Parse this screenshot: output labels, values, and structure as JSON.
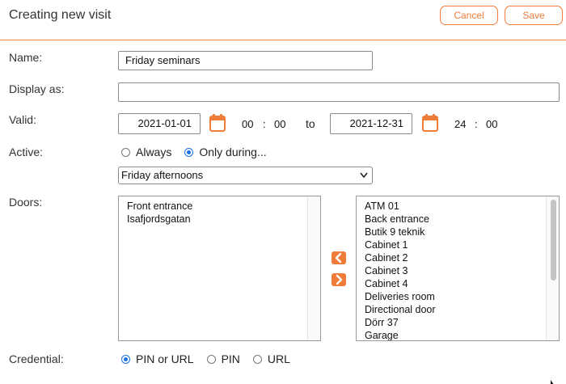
{
  "header": {
    "title": "Creating new visit",
    "cancel_label": "Cancel",
    "save_label": "Save"
  },
  "form": {
    "name": {
      "label": "Name:",
      "value": "Friday seminars"
    },
    "display_as": {
      "label": "Display as:",
      "value": ""
    },
    "valid": {
      "label": "Valid:",
      "start_date": "2021-01-01",
      "start_hour": "00",
      "start_minute": "00",
      "to_word": "to",
      "end_date": "2021-12-31",
      "end_hour": "24",
      "end_minute": "00",
      "separator": ":"
    },
    "active": {
      "label": "Active:",
      "options": [
        "Always",
        "Only during..."
      ],
      "selected": "Only during...",
      "schedule_value": "Friday afternoons"
    },
    "doors": {
      "label": "Doors:",
      "selected_doors": [
        "Front entrance",
        "Isafjordsgatan"
      ],
      "available_doors": [
        "ATM 01",
        "Back entrance",
        "Butik 9 teknik",
        "Cabinet 1",
        "Cabinet 2",
        "Cabinet 3",
        "Cabinet 4",
        "Deliveries room",
        "Directional door",
        "Dörr 37",
        "Garage"
      ]
    },
    "credential": {
      "label": "Credential:",
      "options": [
        "PIN or URL",
        "PIN",
        "URL"
      ],
      "selected": "PIN or URL"
    }
  },
  "colors": {
    "accent": "#f07c3a",
    "radio_selected": "#1a73e8"
  },
  "icons": {
    "calendar": "calendar-icon",
    "move_left": "chevron-left-icon",
    "move_right": "chevron-right-icon",
    "dropdown": "chevron-down-icon"
  }
}
